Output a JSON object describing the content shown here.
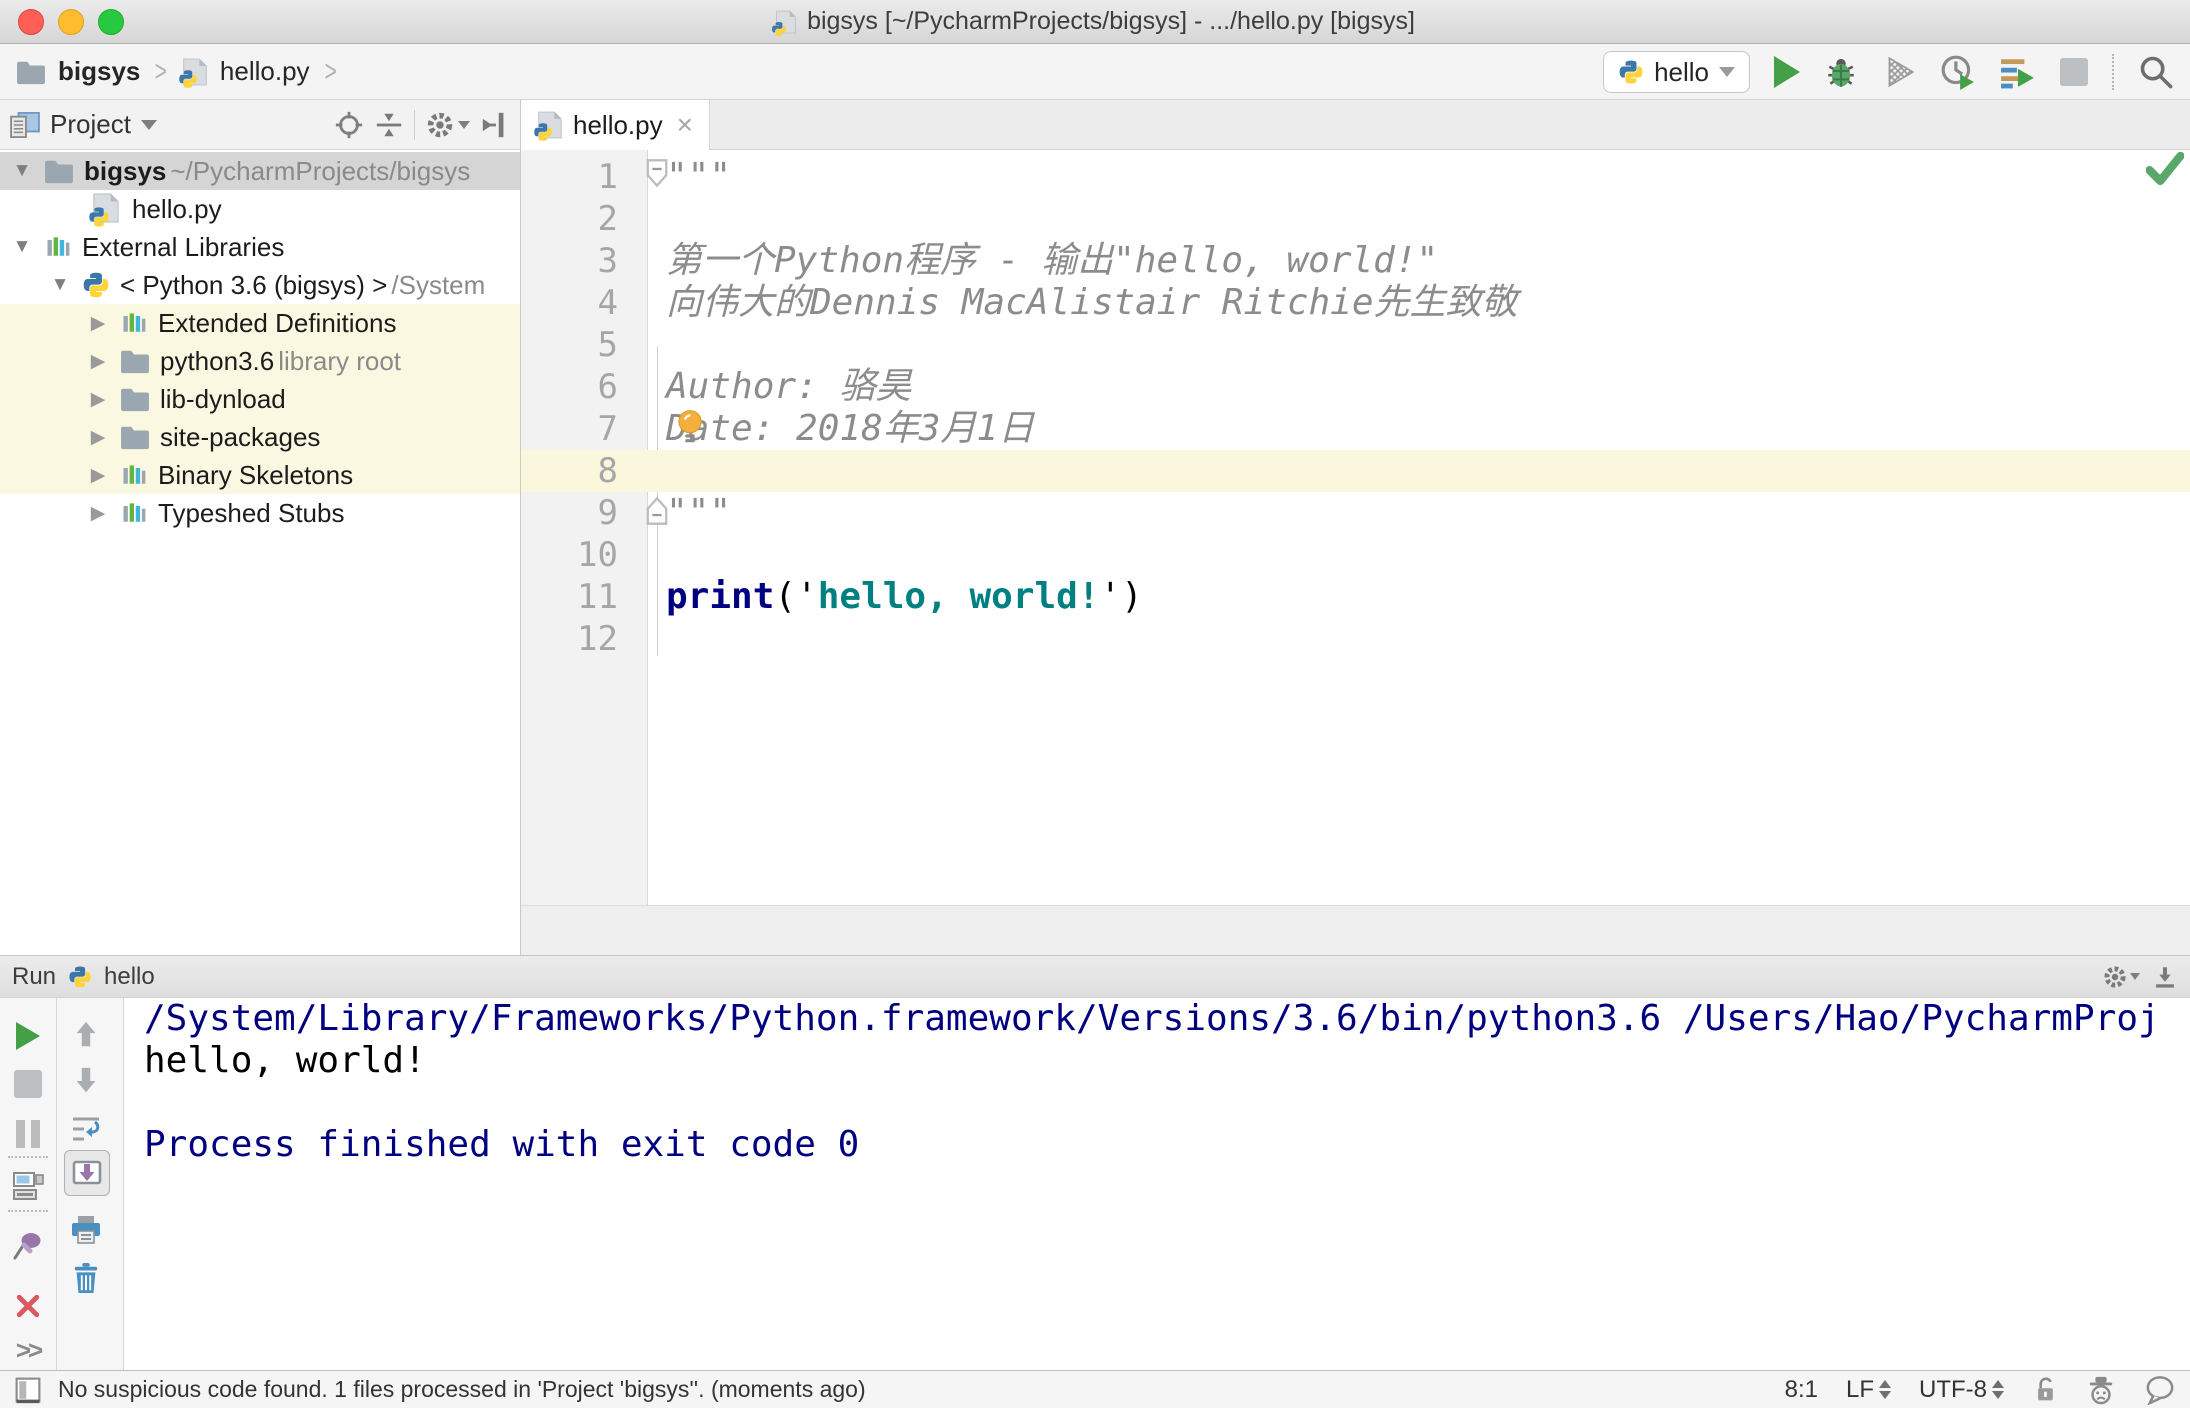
{
  "window": {
    "title": "bigsys [~/PycharmProjects/bigsys] - .../hello.py [bigsys]"
  },
  "navbar": {
    "project": "bigsys",
    "file": "hello.py",
    "separator": ">",
    "run_config": "hello"
  },
  "project": {
    "header": {
      "title": "Project"
    },
    "tree": {
      "items": [
        {
          "label": "bigsys",
          "annotation": "~/PycharmProjects/bigsys"
        },
        {
          "label": "hello.py",
          "annotation": ""
        },
        {
          "label": "External Libraries",
          "annotation": ""
        },
        {
          "label": "< Python 3.6 (bigsys) >",
          "annotation": "/System"
        },
        {
          "label": "Extended Definitions",
          "annotation": ""
        },
        {
          "label": "python3.6",
          "annotation": "library root"
        },
        {
          "label": "lib-dynload",
          "annotation": ""
        },
        {
          "label": "site-packages",
          "annotation": ""
        },
        {
          "label": "Binary Skeletons",
          "annotation": ""
        },
        {
          "label": "Typeshed Stubs",
          "annotation": ""
        }
      ]
    }
  },
  "editor": {
    "tab_label": "hello.py",
    "tab_close": "×",
    "gutter": [
      "1",
      "2",
      "3",
      "4",
      "5",
      "6",
      "7",
      "8",
      "9",
      "10",
      "11",
      "12"
    ],
    "lines": [
      "\"\"\"",
      "",
      "第一个Python程序 - 输出\"hello, world!\"",
      "向伟大的Dennis MacAlistair Ritchie先生致敬",
      "",
      "Author: 骆昊",
      "Date: 2018年3月1日",
      "",
      "\"\"\"",
      ""
    ],
    "code11": {
      "kw": "print",
      "p1": "('",
      "str": "hello, world!",
      "p2": "')"
    }
  },
  "run": {
    "header": {
      "label": "Run",
      "config": "hello"
    },
    "toolbar": {
      "more": ">>"
    },
    "console": {
      "lines": [
        "/System/Library/Frameworks/Python.framework/Versions/3.6/bin/python3.6 /Users/Hao/PycharmProj",
        "hello, world!",
        "",
        "Process finished with exit code 0"
      ]
    }
  },
  "status": {
    "message": "No suspicious code found. 1 files processed in 'Project 'bigsys''. (moments ago)",
    "caret": "8:1",
    "line_ending": "LF",
    "encoding": "UTF-8"
  }
}
